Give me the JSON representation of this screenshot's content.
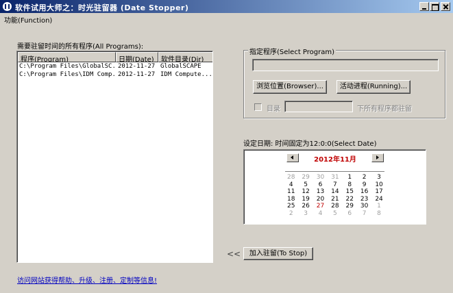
{
  "window": {
    "title": "软件试用大师之：时光驻留器 (Date Stopper)"
  },
  "menu": {
    "function_label": "功能(Function)"
  },
  "programs": {
    "section_label": "需要驻留时间的所有程序(All Programs):",
    "columns": [
      "程序(Program)",
      "日期(Date)",
      "软件目录(Dir)"
    ],
    "rows": [
      [
        "C:\\Program Files\\GlobalSC...",
        "2012-11-27",
        "GlobalSCAPE"
      ],
      [
        "C:\\Program Files\\IDM Comp...",
        "2012-11-27",
        "IDM Compute..."
      ]
    ]
  },
  "select_program": {
    "group_title": "指定程序(Select Program)",
    "path_value": "",
    "browse_label": "浏览位置(Browser)...",
    "running_label": "活动进程(Running)...",
    "dir_checkbox_label": "目录",
    "dir_value": "",
    "dir_suffix": "下所有程序都驻留"
  },
  "date": {
    "label": "设定日期: 时间固定为12:0:0(Select Date)",
    "month_title": "2012年11月",
    "weeks": [
      [
        [
          "28",
          true
        ],
        [
          "29",
          true
        ],
        [
          "30",
          true
        ],
        [
          "31",
          true
        ],
        [
          "1",
          false
        ],
        [
          "2",
          false
        ],
        [
          "3",
          false
        ]
      ],
      [
        [
          "4",
          false
        ],
        [
          "5",
          false
        ],
        [
          "6",
          false
        ],
        [
          "7",
          false
        ],
        [
          "8",
          false
        ],
        [
          "9",
          false
        ],
        [
          "10",
          false
        ]
      ],
      [
        [
          "11",
          false
        ],
        [
          "12",
          false
        ],
        [
          "13",
          false
        ],
        [
          "14",
          false
        ],
        [
          "15",
          false
        ],
        [
          "16",
          false
        ],
        [
          "17",
          false
        ]
      ],
      [
        [
          "18",
          false
        ],
        [
          "19",
          false
        ],
        [
          "20",
          false
        ],
        [
          "21",
          false
        ],
        [
          "22",
          false
        ],
        [
          "23",
          false
        ],
        [
          "24",
          false
        ]
      ],
      [
        [
          "25",
          false
        ],
        [
          "26",
          false
        ],
        [
          "27",
          false
        ],
        [
          "28",
          false
        ],
        [
          "29",
          false
        ],
        [
          "30",
          false
        ],
        [
          "1",
          true
        ]
      ],
      [
        [
          "2",
          true
        ],
        [
          "3",
          true
        ],
        [
          "4",
          true
        ],
        [
          "5",
          true
        ],
        [
          "6",
          true
        ],
        [
          "7",
          true
        ],
        [
          "8",
          true
        ]
      ]
    ],
    "today": "27"
  },
  "actions": {
    "arrow_label": "<<",
    "add_label": "加入驻留(To Stop)"
  },
  "footer": {
    "link_text": "访问网站获得帮助、升级、注册、定制等信息!"
  },
  "colors": {
    "titlebar_start": "#0a246a",
    "titlebar_end": "#a6caf0",
    "month_title": "#c00000",
    "link": "#0000c0"
  }
}
